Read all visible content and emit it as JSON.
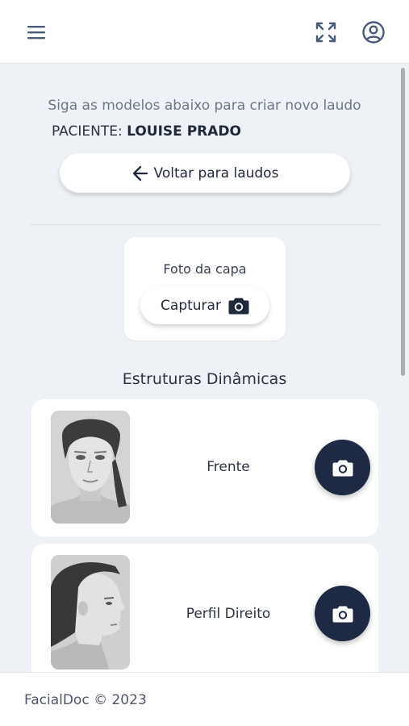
{
  "header": {
    "menu_icon": "menu-icon",
    "fullscreen_icon": "fullscreen-icon",
    "account_icon": "account-circle-icon",
    "accent_color": "#4a5a78"
  },
  "intro": {
    "instructions": "Siga as modelos abaixo para criar novo laudo",
    "patient_label": "PACIENTE:",
    "patient_name": "LOUISE PRADO"
  },
  "back_button": {
    "label": "Voltar para laudos",
    "icon": "arrow-left-icon"
  },
  "cover": {
    "title": "Foto da capa",
    "capture_label": "Capturar",
    "capture_icon": "camera-icon"
  },
  "section": {
    "title": "Estruturas Dinâmicas"
  },
  "poses": [
    {
      "label": "Frente",
      "photo": "frontal-face-photo",
      "action_icon": "camera-icon"
    },
    {
      "label": "Perfil Direito",
      "photo": "right-profile-face-photo",
      "action_icon": "camera-icon"
    }
  ],
  "colors": {
    "background": "#eef1f5",
    "fab": "#1e2a44",
    "text_dark": "#1f2838",
    "text_muted": "#6d7786"
  },
  "footer": {
    "text": "FacialDoc © 2023"
  }
}
